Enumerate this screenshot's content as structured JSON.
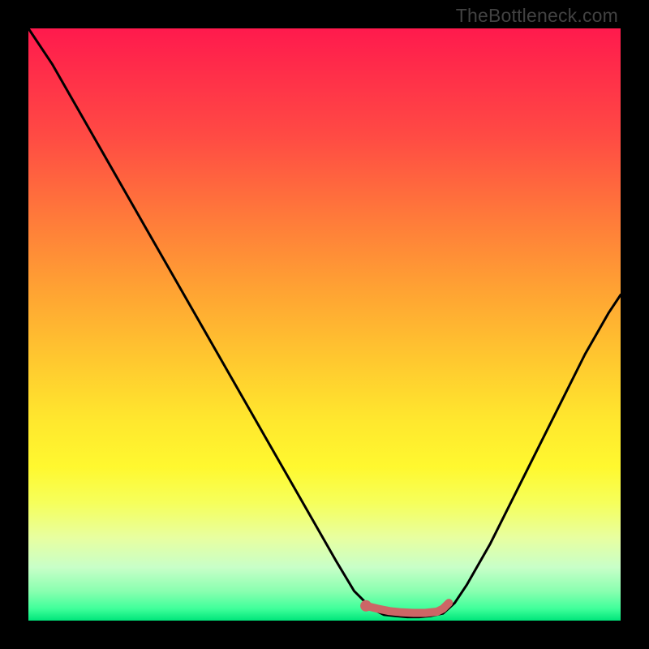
{
  "watermark": "TheBottleneck.com",
  "colors": {
    "frame": "#000000",
    "curve_stroke": "#000000",
    "marker_stroke": "#cc6666",
    "marker_fill": "#cc6666",
    "gradient_top": "#ff1a4d",
    "gradient_bottom": "#00e57a"
  },
  "chart_data": {
    "type": "line",
    "title": "",
    "xlabel": "",
    "ylabel": "",
    "xlim": [
      0,
      100
    ],
    "ylim": [
      0,
      100
    ],
    "series": [
      {
        "name": "bottleneck-curve",
        "x": [
          0,
          4,
          8,
          12,
          16,
          20,
          24,
          28,
          32,
          36,
          40,
          44,
          48,
          52,
          55,
          57,
          59,
          60,
          62,
          64,
          66,
          68,
          70,
          72,
          74,
          78,
          82,
          86,
          90,
          94,
          98,
          100
        ],
        "values": [
          100,
          94,
          87,
          80,
          73,
          66,
          59,
          52,
          45,
          38,
          31,
          24,
          17,
          10,
          5,
          3,
          1.5,
          1,
          0.8,
          0.6,
          0.6,
          0.8,
          1.2,
          3,
          6,
          13,
          21,
          29,
          37,
          45,
          52,
          55
        ]
      },
      {
        "name": "highlight-segment",
        "x": [
          57,
          59,
          61,
          63,
          65,
          67,
          69,
          70,
          71
        ],
        "values": [
          2.5,
          2,
          1.6,
          1.4,
          1.3,
          1.3,
          1.5,
          2,
          3
        ]
      }
    ],
    "markers": [
      {
        "name": "optimal-point",
        "x": 57,
        "y": 2.5
      }
    ],
    "grid": false,
    "legend": false
  }
}
